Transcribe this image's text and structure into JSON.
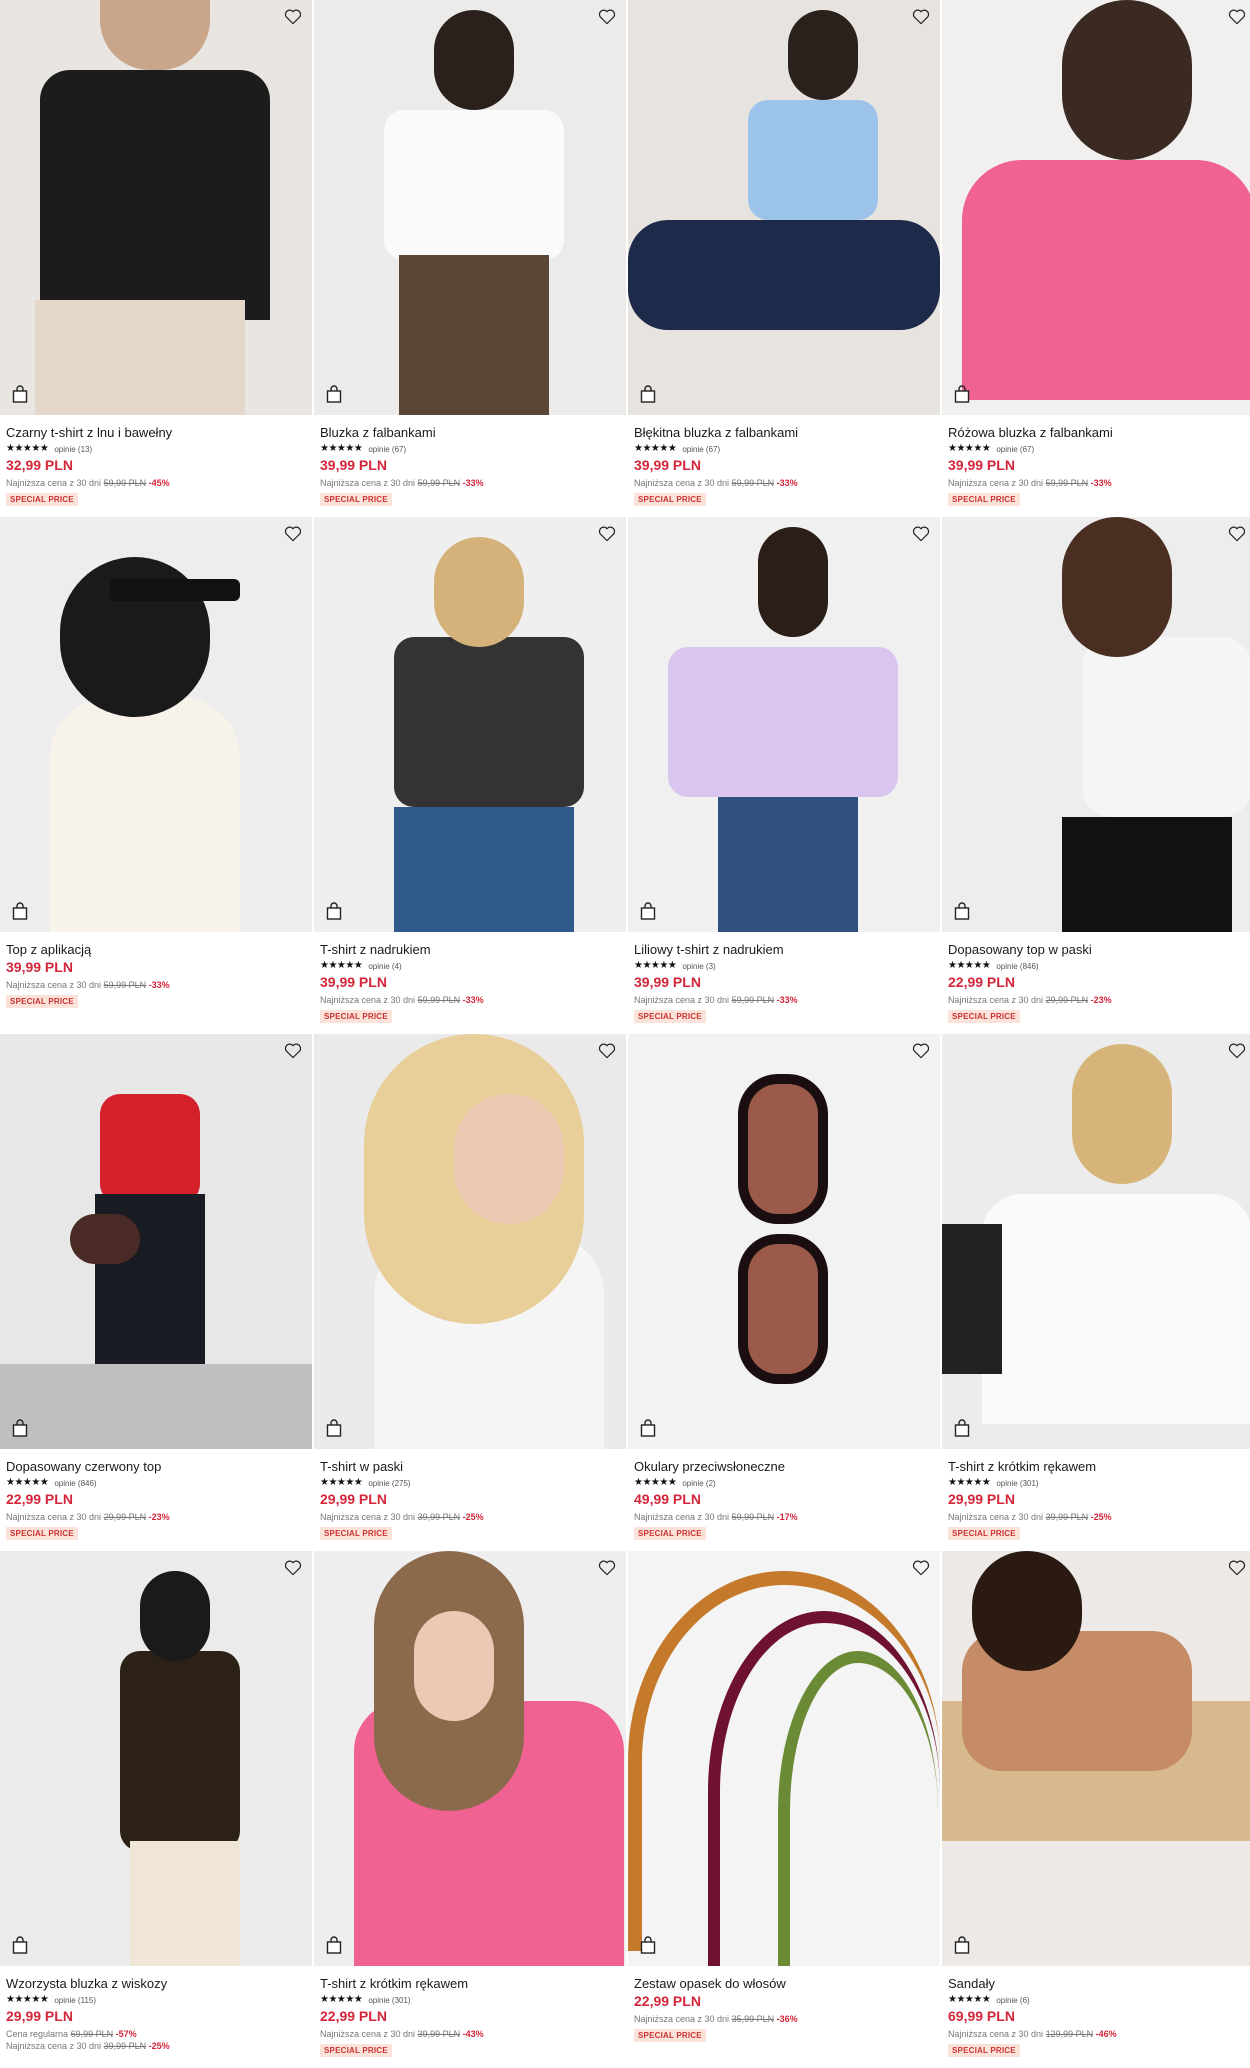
{
  "products": [
    {
      "name": "Czarny t-shirt z lnu i bawełny",
      "stars": "★★★★★",
      "reviews": "opinie (13)",
      "price": "32,99 PLN",
      "lowest_label": "Najniższa cena z 30 dni",
      "old_price": "59,99 PLN",
      "discount": "-45%",
      "badge": "SPECIAL PRICE",
      "bg": "#e9e6e2"
    },
    {
      "name": "Bluzka z falbankami",
      "stars": "★★★★★",
      "reviews": "opinie (67)",
      "price": "39,99 PLN",
      "lowest_label": "Najniższa cena z 30 dni",
      "old_price": "59,99 PLN",
      "discount": "-33%",
      "badge": "SPECIAL PRICE",
      "bg": "#ecebe9"
    },
    {
      "name": "Błękitna bluzka z falbankami",
      "stars": "★★★★★",
      "reviews": "opinie (67)",
      "price": "39,99 PLN",
      "lowest_label": "Najniższa cena z 30 dni",
      "old_price": "59,99 PLN",
      "discount": "-33%",
      "badge": "SPECIAL PRICE",
      "bg": "#e7e4df"
    },
    {
      "name": "Różowa bluzka z falbankami",
      "stars": "★★★★★",
      "reviews": "opinie (67)",
      "price": "39,99 PLN",
      "lowest_label": "Najniższa cena z 30 dni",
      "old_price": "59,99 PLN",
      "discount": "-33%",
      "badge": "SPECIAL PRICE",
      "bg": "#f1f0ef"
    },
    {
      "name": "Top z aplikacją",
      "stars": "",
      "reviews": "",
      "price": "39,99 PLN",
      "lowest_label": "Najniższa cena z 30 dni",
      "old_price": "59,99 PLN",
      "discount": "-33%",
      "badge": "SPECIAL PRICE",
      "bg": "#ededed"
    },
    {
      "name": "T-shirt z nadrukiem",
      "stars": "★★★★★",
      "reviews": "opinie (4)",
      "price": "39,99 PLN",
      "lowest_label": "Najniższa cena z 30 dni",
      "old_price": "59,99 PLN",
      "discount": "-33%",
      "badge": "SPECIAL PRICE",
      "bg": "#efefef"
    },
    {
      "name": "Liliowy t-shirt z nadrukiem",
      "stars": "★★★★★",
      "reviews": "opinie (3)",
      "price": "39,99 PLN",
      "lowest_label": "Najniższa cena z 30 dni",
      "old_price": "59,99 PLN",
      "discount": "-33%",
      "badge": "SPECIAL PRICE",
      "bg": "#f0f0f0"
    },
    {
      "name": "Dopasowany top w paski",
      "stars": "★★★★★",
      "reviews": "opinie (846)",
      "price": "22,99 PLN",
      "lowest_label": "Najniższa cena z 30 dni",
      "old_price": "29,99 PLN",
      "discount": "-23%",
      "badge": "SPECIAL PRICE",
      "bg": "#ededed"
    },
    {
      "name": "Dopasowany czerwony top",
      "stars": "★★★★★",
      "reviews": "opinie (846)",
      "price": "22,99 PLN",
      "lowest_label": "Najniższa cena z 30 dni",
      "old_price": "29,99 PLN",
      "discount": "-23%",
      "badge": "SPECIAL PRICE",
      "bg": "#e7e7e7"
    },
    {
      "name": "T-shirt w paski",
      "stars": "★★★★★",
      "reviews": "opinie (275)",
      "price": "29,99 PLN",
      "lowest_label": "Najniższa cena z 30 dni",
      "old_price": "39,99 PLN",
      "discount": "-25%",
      "badge": "SPECIAL PRICE",
      "bg": "#ebeaea"
    },
    {
      "name": "Okulary przeciwsłoneczne",
      "stars": "★★★★★",
      "reviews": "opinie (2)",
      "price": "49,99 PLN",
      "lowest_label": "Najniższa cena z 30 dni",
      "old_price": "59,99 PLN",
      "discount": "-17%",
      "badge": "SPECIAL PRICE",
      "bg": "#f2f2f2"
    },
    {
      "name": "T-shirt z krótkim rękawem",
      "stars": "★★★★★",
      "reviews": "opinie (301)",
      "price": "29,99 PLN",
      "lowest_label": "Najniższa cena z 30 dni",
      "old_price": "39,99 PLN",
      "discount": "-25%",
      "badge": "SPECIAL PRICE",
      "bg": "#ececec"
    },
    {
      "name": "Wzorzysta bluzka z wiskozy",
      "stars": "★★★★★",
      "reviews": "opinie (115)",
      "price": "29,99 PLN",
      "lowest_label": "Cena regularna",
      "old_price": "69,99 PLN",
      "discount": "-57%",
      "lowest_label2": "Najniższa cena z 30 dni",
      "old_price2": "39,99 PLN",
      "discount2": "-25%",
      "badge": "",
      "bg": "#ebebeb"
    },
    {
      "name": "T-shirt z krótkim rękawem",
      "stars": "★★★★★",
      "reviews": "opinie (301)",
      "price": "22,99 PLN",
      "lowest_label": "Najniższa cena z 30 dni",
      "old_price": "39,99 PLN",
      "discount": "-43%",
      "badge": "SPECIAL PRICE",
      "bg": "#eeeeee"
    },
    {
      "name": "Zestaw opasek do włosów",
      "stars": "",
      "reviews": "",
      "price": "22,99 PLN",
      "lowest_label": "Najniższa cena z 30 dni",
      "old_price": "35,99 PLN",
      "discount": "-36%",
      "badge": "SPECIAL PRICE",
      "bg": "#f4f4f4"
    },
    {
      "name": "Sandały",
      "stars": "★★★★★",
      "reviews": "opinie (6)",
      "price": "69,99 PLN",
      "lowest_label": "Najniższa cena z 30 dni",
      "old_price": "129,99 PLN",
      "discount": "-46%",
      "badge": "SPECIAL PRICE",
      "bg": "#ece9e6"
    }
  ],
  "icons": {
    "wishlist": "heart-outline-icon",
    "cart": "shopping-bag-icon"
  },
  "colors": {
    "price": "#d3263a",
    "badge_bg": "#fbe3d9",
    "badge_text": "#cc3333"
  }
}
